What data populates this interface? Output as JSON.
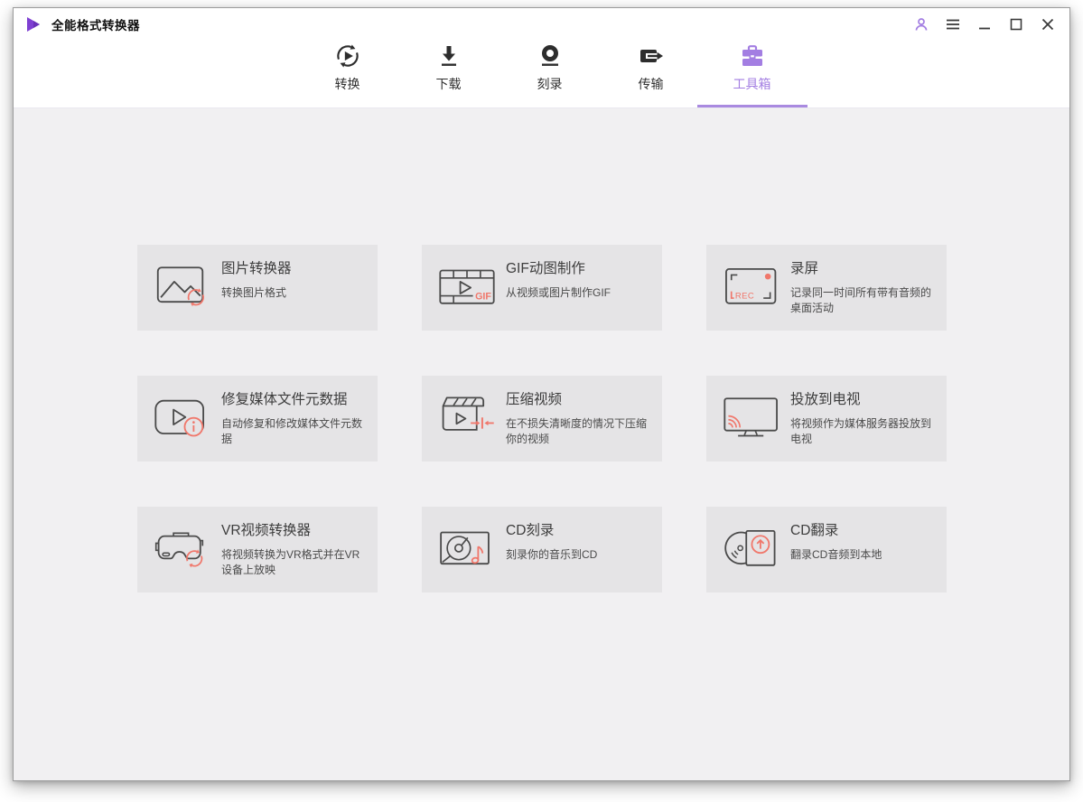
{
  "app": {
    "title": "全能格式转换器",
    "accent_purple": "#a37ee2",
    "logo_purple": "#7e3fd2",
    "accent_salmon": "#f0776b"
  },
  "titlebar": {
    "controls": [
      "account",
      "menu",
      "minimize",
      "maximize",
      "close"
    ]
  },
  "nav": {
    "tabs": [
      {
        "label": "转换",
        "icon": "convert-icon",
        "active": false
      },
      {
        "label": "下载",
        "icon": "download-icon",
        "active": false
      },
      {
        "label": "刻录",
        "icon": "burn-icon",
        "active": false
      },
      {
        "label": "传输",
        "icon": "transfer-icon",
        "active": false
      },
      {
        "label": "工具箱",
        "icon": "toolbox-icon",
        "active": true
      }
    ]
  },
  "icon_texts": {
    "gif": "GIF",
    "rec": "REC"
  },
  "tools": [
    {
      "title": "图片转换器",
      "desc": "转换图片格式",
      "icon": "image-converter-icon"
    },
    {
      "title": "GIF动图制作",
      "desc": "从视频或图片制作GIF",
      "icon": "gif-maker-icon"
    },
    {
      "title": "录屏",
      "desc": "记录同一时间所有带有音频的桌面活动",
      "icon": "screen-recorder-icon"
    },
    {
      "title": "修复媒体文件元数据",
      "desc": "自动修复和修改媒体文件元数据",
      "icon": "fix-metadata-icon"
    },
    {
      "title": "压缩视频",
      "desc": "在不损失清晰度的情况下压缩你的视频",
      "icon": "compress-video-icon"
    },
    {
      "title": "投放到电视",
      "desc": "将视频作为媒体服务器投放到电视",
      "icon": "cast-to-tv-icon"
    },
    {
      "title": "VR视频转换器",
      "desc": "将视频转换为VR格式并在VR设备上放映",
      "icon": "vr-converter-icon"
    },
    {
      "title": "CD刻录",
      "desc": "刻录你的音乐到CD",
      "icon": "cd-burn-icon"
    },
    {
      "title": "CD翻录",
      "desc": "翻录CD音频到本地",
      "icon": "cd-rip-icon"
    }
  ]
}
